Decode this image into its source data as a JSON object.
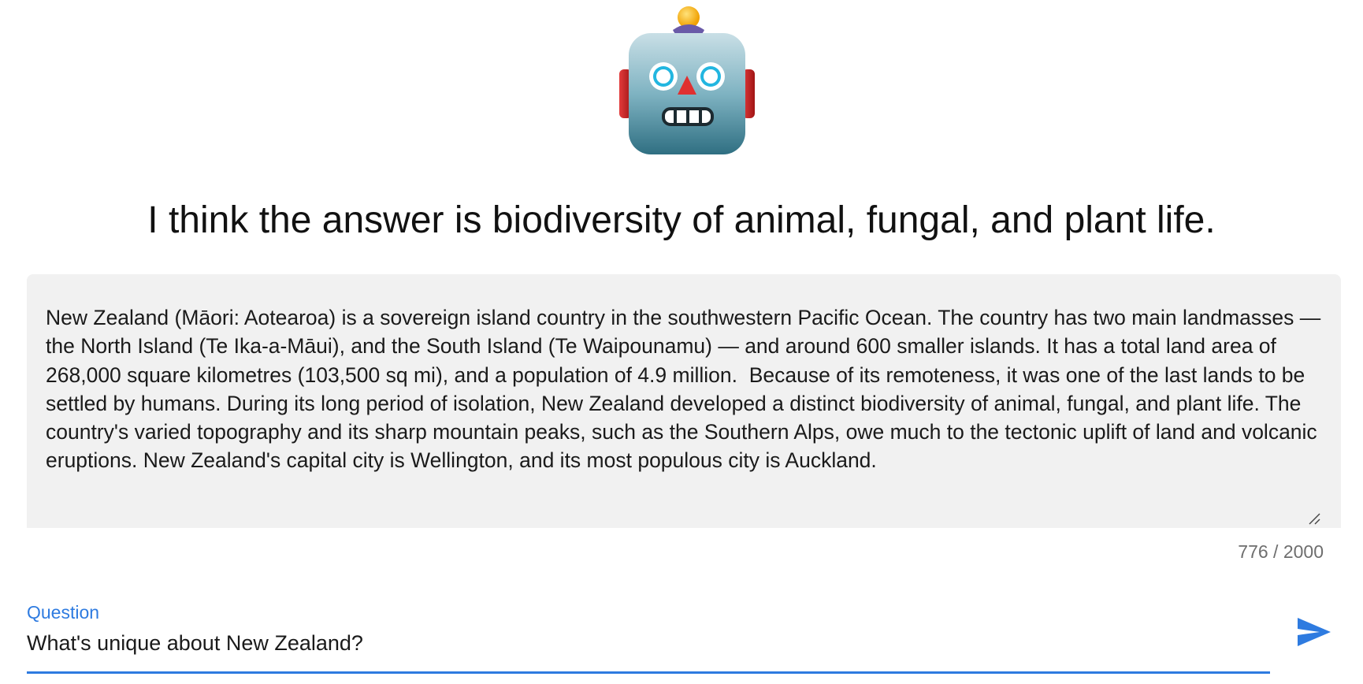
{
  "avatar": {
    "icon": "robot-face-icon"
  },
  "answer": {
    "text": "I think the answer is biodiversity of animal, fungal, and plant life."
  },
  "context": {
    "text": "New Zealand (Māori: Aotearoa) is a sovereign island country in the southwestern Pacific Ocean. The country has two main landmasses — the North Island (Te Ika-a-Māui), and the South Island (Te Waipounamu) — and around 600 smaller islands. It has a total land area of 268,000 square kilometres (103,500 sq mi), and a population of 4.9 million.  Because of its remoteness, it was one of the last lands to be settled by humans. During its long period of isolation, New Zealand developed a distinct biodiversity of animal, fungal, and plant life. The country's varied topography and its sharp mountain peaks, such as the Southern Alps, owe much to the tectonic uplift of land and volcanic eruptions. New Zealand's capital city is Wellington, and its most populous city is Auckland.",
    "counter": "776 / 2000",
    "resize_icon": "resize-handle-icon"
  },
  "question": {
    "label": "Question",
    "value": "What's unique about New Zealand?"
  },
  "send": {
    "icon": "send-icon"
  },
  "colors": {
    "accent": "#2e7be0",
    "context_bg": "#f1f1f1",
    "counter_text": "#6e6e6e"
  }
}
